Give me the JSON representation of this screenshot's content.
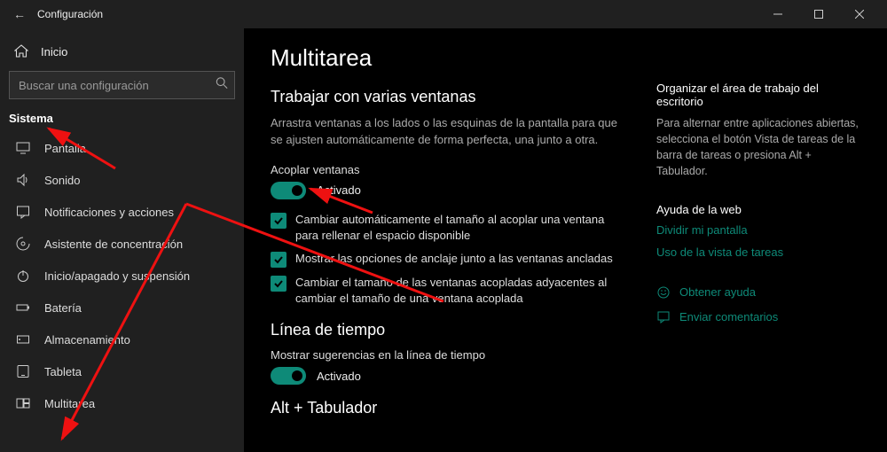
{
  "window": {
    "title": "Configuración"
  },
  "sidebar": {
    "home": "Inicio",
    "search_placeholder": "Buscar una configuración",
    "category": "Sistema",
    "items": [
      {
        "label": "Pantalla"
      },
      {
        "label": "Sonido"
      },
      {
        "label": "Notificaciones y acciones"
      },
      {
        "label": "Asistente de concentración"
      },
      {
        "label": "Inicio/apagado y suspensión"
      },
      {
        "label": "Batería"
      },
      {
        "label": "Almacenamiento"
      },
      {
        "label": "Tableta"
      },
      {
        "label": "Multitarea"
      }
    ]
  },
  "main": {
    "title": "Multitarea",
    "section1_heading": "Trabajar con varias ventanas",
    "section1_desc": "Arrastra ventanas a los lados o las esquinas de la pantalla para que se ajusten automáticamente de forma perfecta, una junto a otra.",
    "snap_label": "Acoplar ventanas",
    "snap_state": "Activado",
    "check1": "Cambiar automáticamente el tamaño al acoplar una ventana para rellenar el espacio disponible",
    "check2": "Mostrar las opciones de anclaje junto a las ventanas ancladas",
    "check3": "Cambiar el tamaño de las ventanas acopladas adyacentes al cambiar el tamaño de una ventana acoplada",
    "section2_heading": "Línea de tiempo",
    "timeline_label": "Mostrar sugerencias en la línea de tiempo",
    "timeline_state": "Activado",
    "section3_heading": "Alt + Tabulador"
  },
  "side": {
    "org_heading": "Organizar el área de trabajo del escritorio",
    "org_desc": "Para alternar entre aplicaciones abiertas, selecciona el botón Vista de tareas de la barra de tareas o presiona Alt + Tabulador.",
    "web_heading": "Ayuda de la web",
    "link1": "Dividir mi pantalla",
    "link2": "Uso de la vista de tareas",
    "help": "Obtener ayuda",
    "feedback": "Enviar comentarios"
  }
}
